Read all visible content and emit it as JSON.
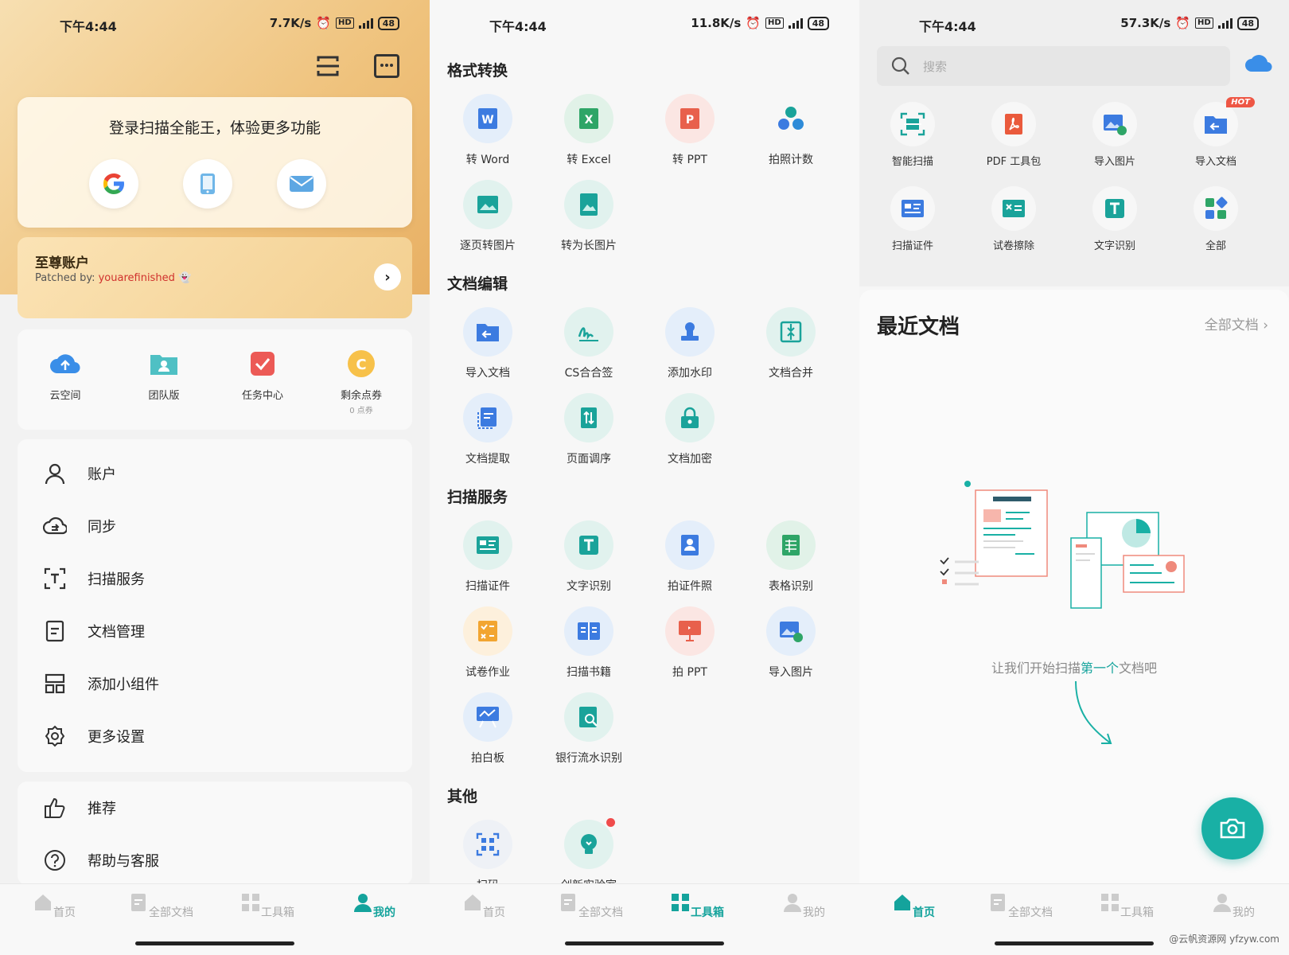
{
  "panel_me": {
    "status": {
      "time": "下午4:44",
      "speed": "7.7K/s",
      "battery": "48"
    },
    "login": {
      "title": "登录扫描全能王，体验更多功能"
    },
    "vip": {
      "title": "至尊账户",
      "patched_prefix": "Patched by: ",
      "patched_name": "youarefinished"
    },
    "quick": [
      {
        "label": "云空间",
        "icon": "cloud-upload-icon"
      },
      {
        "label": "团队版",
        "icon": "team-folder-icon"
      },
      {
        "label": "任务中心",
        "icon": "task-check-icon"
      },
      {
        "label": "剩余点券",
        "sub": "0 点券",
        "icon": "coin-icon"
      }
    ],
    "menu": [
      {
        "label": "账户",
        "icon": "person-icon"
      },
      {
        "label": "同步",
        "icon": "cloud-sync-icon"
      },
      {
        "label": "扫描服务",
        "icon": "scan-text-icon"
      },
      {
        "label": "文档管理",
        "icon": "document-icon"
      },
      {
        "label": "添加小组件",
        "icon": "widget-icon"
      },
      {
        "label": "更多设置",
        "icon": "gear-icon"
      }
    ],
    "menu2": [
      {
        "label": "推荐",
        "icon": "thumbs-up-icon"
      },
      {
        "label": "帮助与客服",
        "icon": "help-icon"
      }
    ]
  },
  "panel_tools": {
    "status": {
      "time": "下午4:44",
      "speed": "11.8K/s",
      "battery": "48"
    },
    "sections": {
      "format": "格式转换",
      "edit": "文档编辑",
      "scan": "扫描服务",
      "other": "其他"
    },
    "format_tools": [
      "转 Word",
      "转 Excel",
      "转 PPT",
      "拍照计数",
      "逐页转图片",
      "转为长图片"
    ],
    "edit_tools": [
      "导入文档",
      "CS合合签",
      "添加水印",
      "文档合并",
      "文档提取",
      "页面调序",
      "文档加密"
    ],
    "scan_tools": [
      "扫描证件",
      "文字识别",
      "拍证件照",
      "表格识别",
      "试卷作业",
      "扫描书籍",
      "拍 PPT",
      "导入图片",
      "拍白板",
      "银行流水识别"
    ],
    "other_tools": [
      "扫码",
      "创新实验室"
    ]
  },
  "panel_home": {
    "status": {
      "time": "下午4:44",
      "speed": "57.3K/s",
      "battery": "48"
    },
    "search_placeholder": "搜索",
    "tools": [
      "智能扫描",
      "PDF 工具包",
      "导入图片",
      "导入文档",
      "扫描证件",
      "试卷擦除",
      "文字识别",
      "全部"
    ],
    "hot_badge": "HOT",
    "recent_title": "最近文档",
    "recent_all": "全部文档",
    "empty_prefix": "让我们开始扫描",
    "empty_highlight": "第一个",
    "empty_suffix": "文档吧"
  },
  "nav": [
    "首页",
    "全部文档",
    "工具箱",
    "我的"
  ],
  "watermark": "@云帆资源网 yfzyw.com",
  "colors": {
    "accent": "#14a39c",
    "vip_gold": "#efc27c",
    "red": "#d0312d"
  }
}
